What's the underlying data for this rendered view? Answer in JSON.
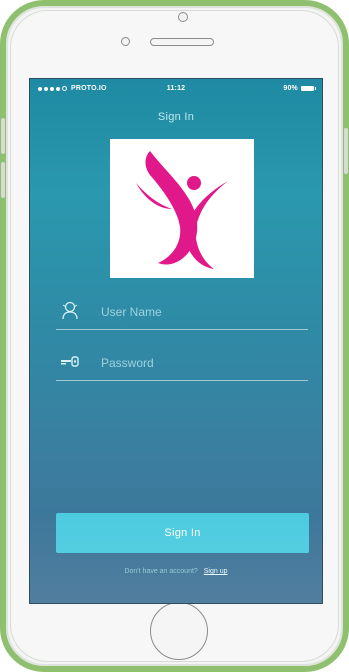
{
  "status_bar": {
    "carrier": "PROTO.IO",
    "time": "11:12",
    "battery": "90%"
  },
  "nav": {
    "title": "Sign In"
  },
  "logo": {
    "icon": "dancer-logo",
    "color": "#e0188a"
  },
  "form": {
    "username_placeholder": "User Name",
    "username_value": "",
    "password_placeholder": "Password",
    "password_value": "",
    "username_icon": "user-icon",
    "password_icon": "key-icon"
  },
  "signin_button": {
    "label": "Sign In"
  },
  "footer": {
    "prompt": "Don't have an account?",
    "signup_link": "Sign up"
  },
  "colors": {
    "device_frame": "#8fc06f",
    "accent_button": "#4ccbdf",
    "screen_top": "#1f8aa3",
    "screen_bottom": "#3e6f94"
  }
}
